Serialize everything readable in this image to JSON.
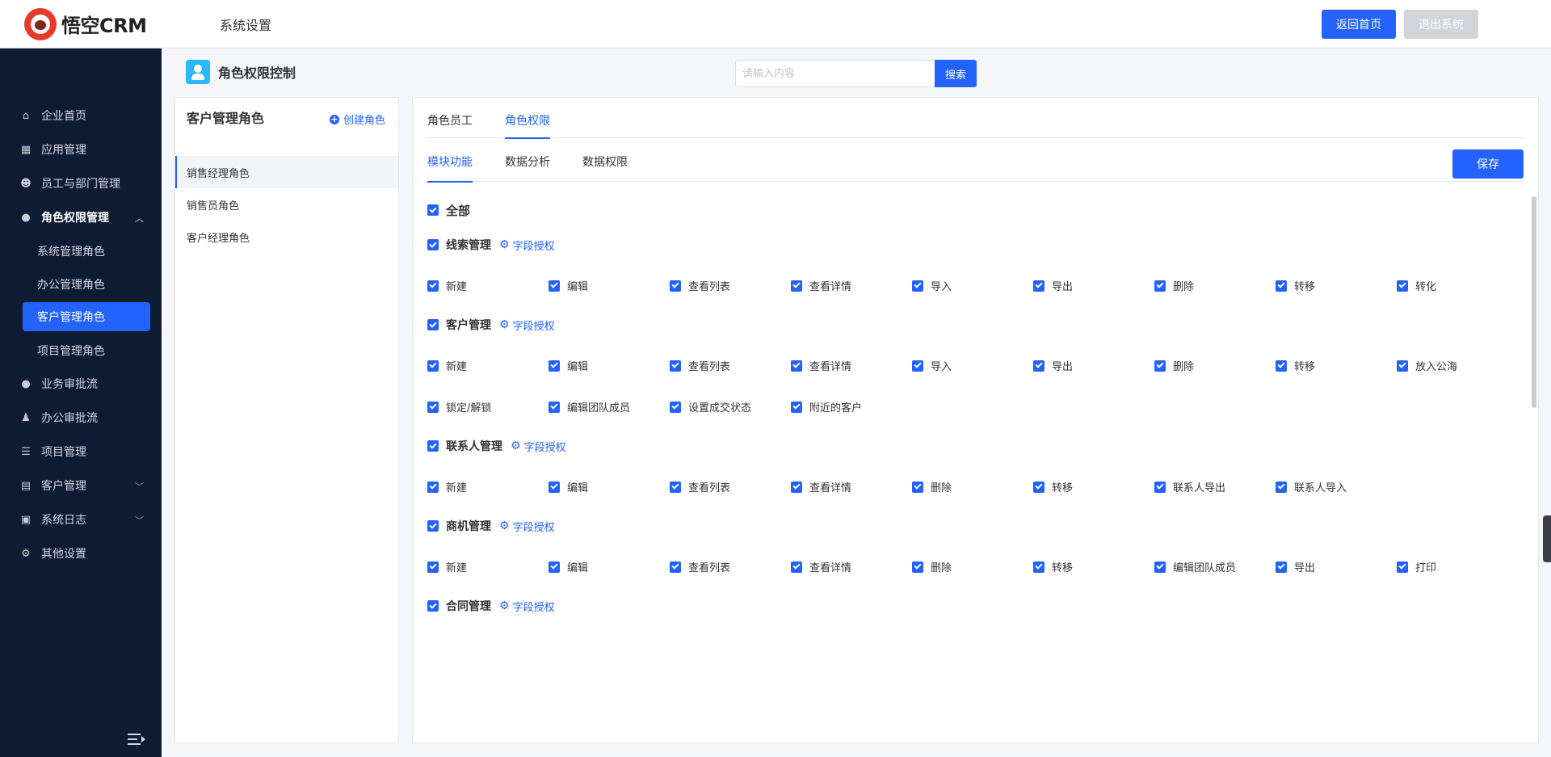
{
  "header": {
    "logo_text": "悟空CRM",
    "title": "系统设置",
    "back_home": "返回首页",
    "logout": "退出系统"
  },
  "sidebar": {
    "items": [
      {
        "label": "企业首页",
        "icon": "home-icon"
      },
      {
        "label": "应用管理",
        "icon": "grid-icon"
      },
      {
        "label": "员工与部门管理",
        "icon": "users-icon"
      },
      {
        "label": "角色权限管理",
        "icon": "user-icon"
      },
      {
        "label": "业务审批流",
        "icon": "user-icon"
      },
      {
        "label": "办公审批流",
        "icon": "stamp-icon"
      },
      {
        "label": "项目管理",
        "icon": "list-icon"
      },
      {
        "label": "客户管理",
        "icon": "building-icon"
      },
      {
        "label": "系统日志",
        "icon": "clipboard-icon"
      },
      {
        "label": "其他设置",
        "icon": "gear-icon"
      }
    ],
    "subitems": [
      "系统管理角色",
      "办公管理角色",
      "客户管理角色",
      "项目管理角色"
    ]
  },
  "page": {
    "title": "角色权限控制",
    "search_placeholder": "请输入内容",
    "search_button": "搜索"
  },
  "roles": {
    "title": "客户管理角色",
    "create": "创建角色",
    "items": [
      "销售经理角色",
      "销售员角色",
      "客户经理角色"
    ]
  },
  "perm": {
    "tabs": [
      "角色员工",
      "角色权限"
    ],
    "subtabs": [
      "模块功能",
      "数据分析",
      "数据权限"
    ],
    "save": "保存",
    "all": "全部",
    "field_auth": "字段授权",
    "modules": [
      {
        "name": "线索管理",
        "perms": [
          "新建",
          "编辑",
          "查看列表",
          "查看详情",
          "导入",
          "导出",
          "删除",
          "转移",
          "转化"
        ]
      },
      {
        "name": "客户管理",
        "perms": [
          "新建",
          "编辑",
          "查看列表",
          "查看详情",
          "导入",
          "导出",
          "删除",
          "转移",
          "放入公海",
          "锁定/解锁",
          "编辑团队成员",
          "设置成交状态",
          "附近的客户"
        ]
      },
      {
        "name": "联系人管理",
        "perms": [
          "新建",
          "编辑",
          "查看列表",
          "查看详情",
          "删除",
          "转移",
          "联系人导出",
          "联系人导入"
        ]
      },
      {
        "name": "商机管理",
        "perms": [
          "新建",
          "编辑",
          "查看列表",
          "查看详情",
          "删除",
          "转移",
          "编辑团队成员",
          "导出",
          "打印"
        ]
      },
      {
        "name": "合同管理",
        "perms": []
      }
    ]
  },
  "colors": {
    "primary": "#2362fb",
    "sidebar_bg": "#0f1b33"
  }
}
